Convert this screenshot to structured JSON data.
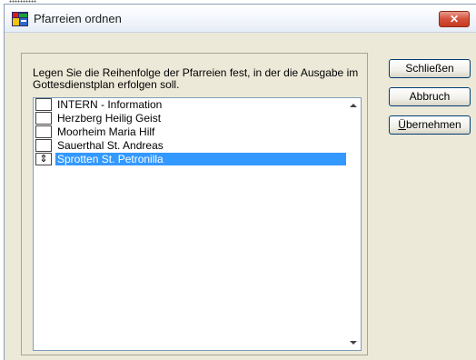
{
  "window": {
    "title": "Pfarreien ordnen",
    "close_glyph": "✕"
  },
  "instruction": "Legen Sie die Reihenfolge der Pfarreien fest, in der die Ausgabe im Gottesdienstplan erfolgen soll.",
  "parishes": [
    {
      "label": "INTERN - Information",
      "selected": false
    },
    {
      "label": "Herzberg Heilig Geist",
      "selected": false
    },
    {
      "label": "Moorheim Maria Hilf",
      "selected": false
    },
    {
      "label": "Sauerthal St. Andreas",
      "selected": false
    },
    {
      "label": "Sprotten St. Petronilla",
      "selected": true
    }
  ],
  "move_handle_glyph": "⇕",
  "buttons": {
    "close": "Schließen",
    "cancel": "Abbruch",
    "apply_prefix": "Ü",
    "apply_rest": "bernehmen"
  },
  "icons": {
    "app": "app-window-icon",
    "close": "close-icon",
    "scroll_up": "scroll-up-arrow-icon",
    "scroll_down": "scroll-down-arrow-icon",
    "move": "move-updown-icon"
  },
  "colors": {
    "selection": "#3399ff",
    "dialog_background": "#ece9d8",
    "close_button": "#d4513b"
  }
}
